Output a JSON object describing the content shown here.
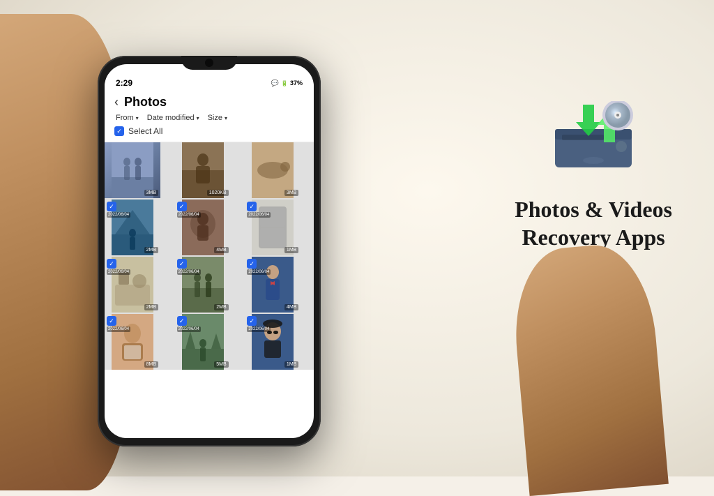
{
  "background": {
    "color": "#f5f0e8"
  },
  "phone": {
    "status_bar": {
      "time": "2:29",
      "battery": "37%",
      "icons": "📶 WiFi BT"
    },
    "header": {
      "back_label": "‹",
      "title": "Photos",
      "filter_from": "From",
      "filter_date": "Date modified",
      "filter_size": "Size",
      "select_all": "Select All"
    },
    "photos": [
      {
        "id": 1,
        "size": "3MB",
        "date": "",
        "color": "p1",
        "row": 1
      },
      {
        "id": 2,
        "size": "1020KB",
        "date": "",
        "color": "p2",
        "row": 1
      },
      {
        "id": 3,
        "size": "3MB",
        "date": "",
        "color": "p3",
        "row": 1
      },
      {
        "id": 4,
        "size": "2MB",
        "date": "2022/06/04",
        "color": "p4",
        "row": 2
      },
      {
        "id": 5,
        "size": "4MB",
        "date": "2022/06/04",
        "color": "p5",
        "row": 2
      },
      {
        "id": 6,
        "size": "1MB",
        "date": "2022/06/04",
        "color": "p6",
        "row": 2
      },
      {
        "id": 7,
        "size": "2MB",
        "date": "2022/06/04",
        "color": "p7",
        "row": 3
      },
      {
        "id": 8,
        "size": "2MB",
        "date": "2022/06/04",
        "color": "p8",
        "row": 3
      },
      {
        "id": 9,
        "size": "4MB",
        "date": "2022/06/04",
        "color": "p9",
        "row": 3
      },
      {
        "id": 10,
        "size": "8MB",
        "date": "2022/06/04",
        "color": "p10",
        "row": 4
      },
      {
        "id": 11,
        "size": "5MB",
        "date": "2022/06/04",
        "color": "p11",
        "row": 4
      },
      {
        "id": 12,
        "size": "1MB",
        "date": "2022/06/04",
        "color": "p12",
        "row": 4
      }
    ]
  },
  "right_panel": {
    "title_line1": "Photos & Videos",
    "title_line2": "Recovery Apps"
  }
}
